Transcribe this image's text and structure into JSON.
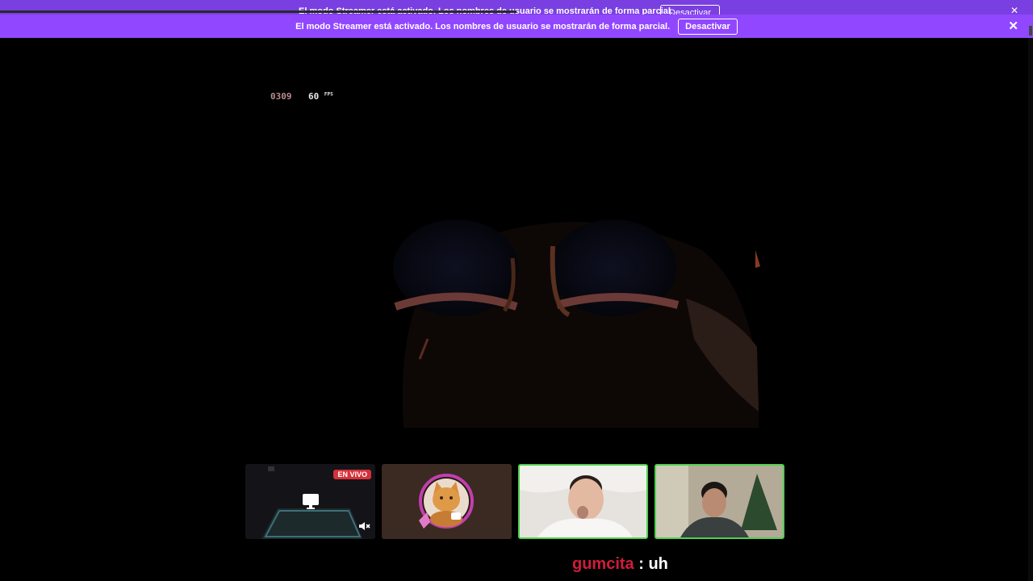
{
  "ghost_banner": {
    "text": "El modo Streamer está activado. Los nombres de usuario se mostrarán de forma parcial.",
    "button": "Desactivar",
    "close_icon": "close-icon"
  },
  "banner": {
    "text": "El modo Streamer está activado. Los nombres de usuario se mostrarán de forma parcial.",
    "button": "Desactivar",
    "close_icon": "close-icon"
  },
  "hud": {
    "clock": "0309",
    "fps_value": "60",
    "fps_unit": "FPS"
  },
  "participants": [
    {
      "type": "screen-share",
      "badge": "EN VIVO",
      "icon": "monitor-icon",
      "mute_icon": "speaker-muted-icon"
    },
    {
      "type": "avatar",
      "icon": "cat-avatar"
    },
    {
      "type": "camera",
      "speaking": true
    },
    {
      "type": "camera",
      "speaking": true
    }
  ],
  "chat": {
    "username": "gumcita",
    "separator": " : ",
    "message": "uh"
  },
  "colors": {
    "banner": "#9147ff",
    "live_badge": "#d6303a",
    "speaking_border": "#4fd14f",
    "chat_username": "#d01c3a"
  }
}
